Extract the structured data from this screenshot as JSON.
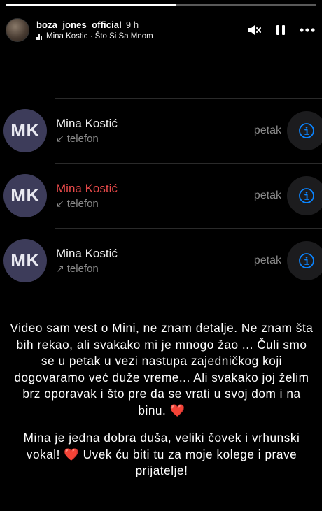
{
  "story": {
    "progress_fraction": 0.55,
    "username": "boza_jones_official",
    "time": "9 h",
    "music": "Mina Kostic · Što Si Sa Mnom"
  },
  "icons": {
    "mute": "speaker-muted-icon",
    "pause": "pause-icon",
    "more": "more-dots-icon",
    "info": "info-circle-icon",
    "music": "music-bars-icon"
  },
  "calls": [
    {
      "initials": "MK",
      "name": "Mina Kostić",
      "type": "telefon",
      "direction_arrow": "↙",
      "day": "petak",
      "missed": false
    },
    {
      "initials": "MK",
      "name": "Mina Kostić",
      "type": "telefon",
      "direction_arrow": "↙",
      "day": "petak",
      "missed": true
    },
    {
      "initials": "MK",
      "name": "Mina Kostić",
      "type": "telefon",
      "direction_arrow": "↗",
      "day": "petak",
      "missed": false
    }
  ],
  "colors": {
    "missed_call": "#e84a4a",
    "info_icon": "#0a84ff",
    "avatar_bg": "#3d3c5a"
  },
  "caption": {
    "p1_text": "Video sam vest o Mini, ne znam detalje. Ne znam šta bih rekao, ali svakako mi je mnogo žao ... Čuli smo se u petak u vezi nastupa zajedničkog koji dogovaramo već duže vreme... Ali svakako joj želim brz oporavak i što pre da se vrati u svoj dom i na binu.",
    "p1_emoji": "❤️",
    "p2_text_a": "Mina je jedna dobra duša, veliki čovek i vrhunski vokal!",
    "p2_emoji": "❤️",
    "p2_text_b": "Uvek ću biti tu za moje kolege i prave prijatelje!"
  }
}
